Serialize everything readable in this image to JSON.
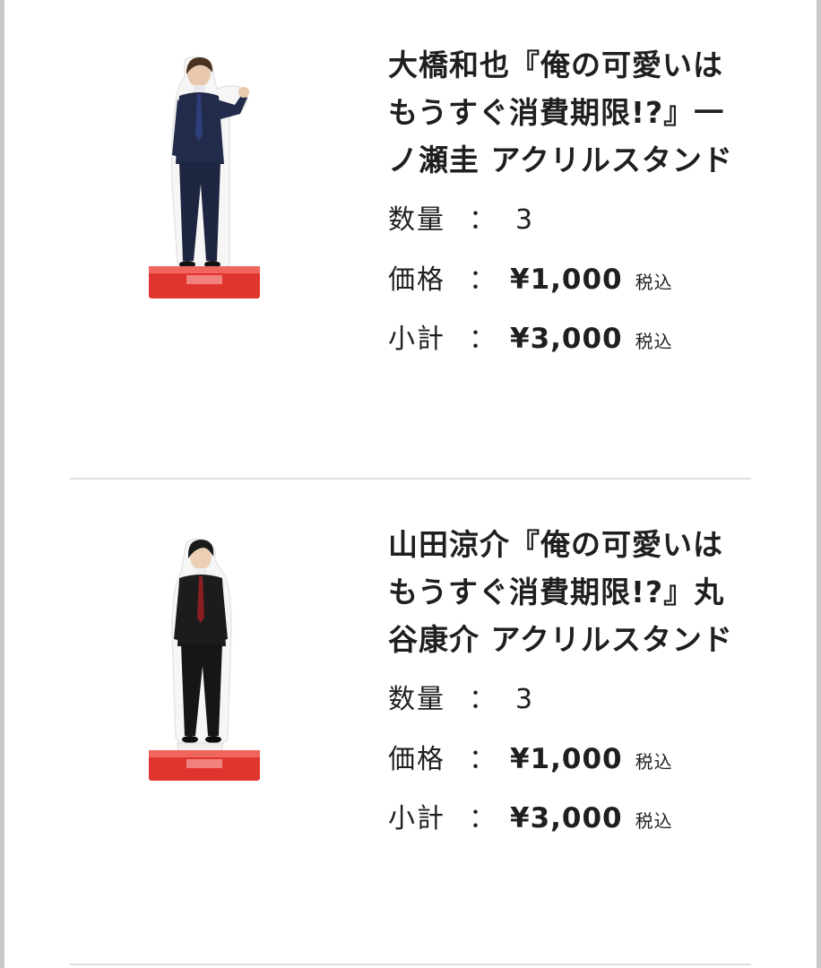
{
  "items": [
    {
      "title": "大橋和也『俺の可愛いはもうすぐ消費期限!?』一ノ瀬圭 アクリルスタンド",
      "quantity_label": "数量",
      "quantity": "3",
      "price_label": "価格",
      "price": "¥1,000",
      "price_tax": "税込",
      "subtotal_label": "小計",
      "subtotal": "¥3,000",
      "subtotal_tax": "税込",
      "colon": "：",
      "image": {
        "suit_color": "#232b4a",
        "tie_color": "#2d3f7a",
        "base_color": "#e0352f"
      }
    },
    {
      "title": "山田涼介『俺の可愛いはもうすぐ消費期限!?』丸谷康介 アクリルスタンド",
      "quantity_label": "数量",
      "quantity": "3",
      "price_label": "価格",
      "price": "¥1,000",
      "price_tax": "税込",
      "subtotal_label": "小計",
      "subtotal": "¥3,000",
      "subtotal_tax": "税込",
      "colon": "：",
      "image": {
        "suit_color": "#1c1c1c",
        "tie_color": "#8a1e22",
        "base_color": "#e0352f"
      }
    }
  ],
  "colors": {
    "divider": "#dedede",
    "text": "#1f1f1f",
    "frame": "#c9c9c9"
  }
}
